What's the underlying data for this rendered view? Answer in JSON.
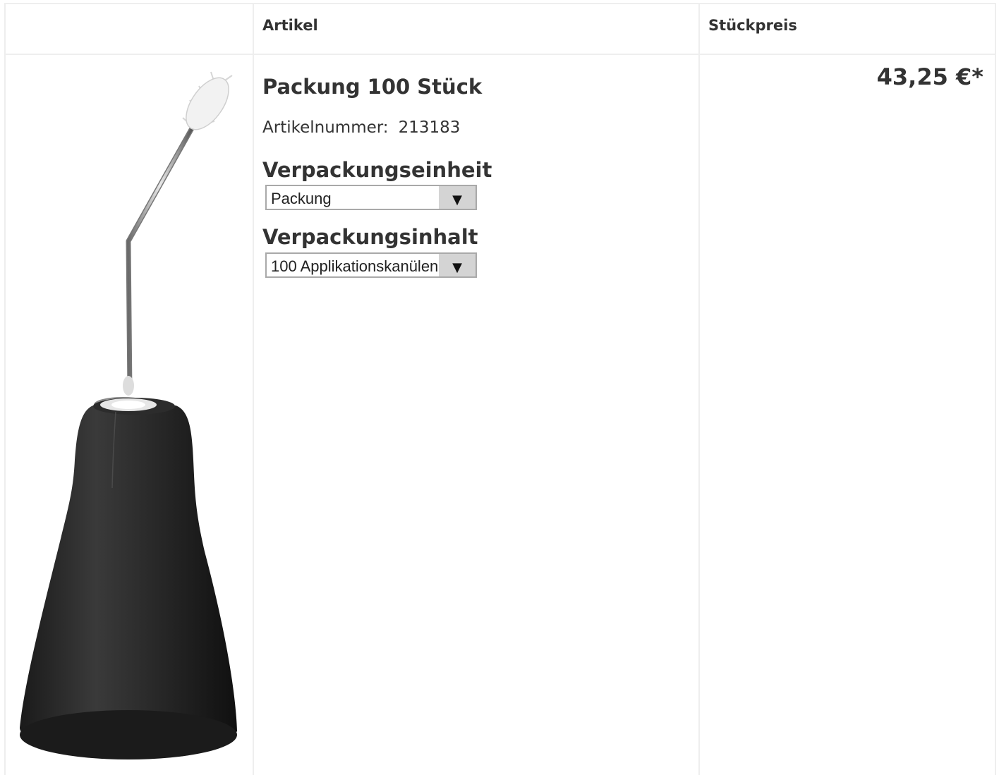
{
  "table": {
    "header_artikel": "Artikel",
    "header_stueckpreis": "Stückpreis"
  },
  "product": {
    "title": "Packung 100 Stück",
    "artnr_label": "Artikelnummer:",
    "artnr_value": "213183",
    "image_icon": "applicator-cannula-image",
    "unit_label": "Verpackungseinheit",
    "unit_selected": "Packung",
    "content_label": "Verpackungsinhalt",
    "content_selected": "100 Applikationskanülen",
    "price": "43,25 €*"
  }
}
